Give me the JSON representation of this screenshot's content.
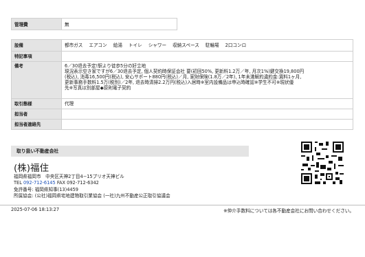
{
  "management": {
    "label": "管理費",
    "value": "無"
  },
  "rows": [
    {
      "key": "設備",
      "type": "equipment",
      "items": [
        "都市ガス",
        "エアコン",
        "給湯",
        "トイレ",
        "シャワー",
        "収納スペース",
        "駐輪場",
        "2口コンロ"
      ]
    },
    {
      "key": "特記事項",
      "type": "text",
      "lines": [
        ""
      ]
    },
    {
      "key": "備考",
      "type": "text",
      "lines": [
        "6／30退去予定!駅より徒歩5分の好立地",
        "現況表示空き家ですが6／30退去予定, 個人契約時保証会社 要(初回50%, 更新料1.2万／年, 月次1%)鍵交換19,800円",
        "(税込), 消毒16,500円(税込), 安心サポート880円(税込)／月, 家財保険(1.8万／2年), 1年未満解約違約金:賃料1ヶ月,",
        "更新事務手数料1.5万(税別)／2年, 退去時清掃2.2万円(税込)入居時※室内設備品は申込時確認※学生不可※現状優",
        "先※写真は別部屋◆原則電子契約"
      ]
    },
    {
      "key": "取引態様",
      "type": "text",
      "lines": [
        "代理"
      ]
    },
    {
      "key": "担当者",
      "type": "text",
      "lines": [
        ""
      ]
    },
    {
      "key": "担当者連絡先",
      "type": "text",
      "lines": [
        ""
      ]
    }
  ],
  "agent": {
    "header": "取り扱い不動産会社",
    "name": "(株)福住",
    "address": "福岡県福岡市　中央区天神2丁目4−15プリオ天神ビル",
    "tel_label": "TEL",
    "tel": "092-712-6145",
    "fax_label": "FAX",
    "fax": "092-712-6342",
    "license": "免許番号: 福岡県知事(13)4459",
    "association": "所属協会: (公社)福岡県宅地建物取引業協会 (一社)九州不動産公正取引協議会"
  },
  "footer": {
    "timestamp": "2025-07-06 18:13:27",
    "note": "※仲介手数料については各不動産会社にお問い合わせください。"
  }
}
